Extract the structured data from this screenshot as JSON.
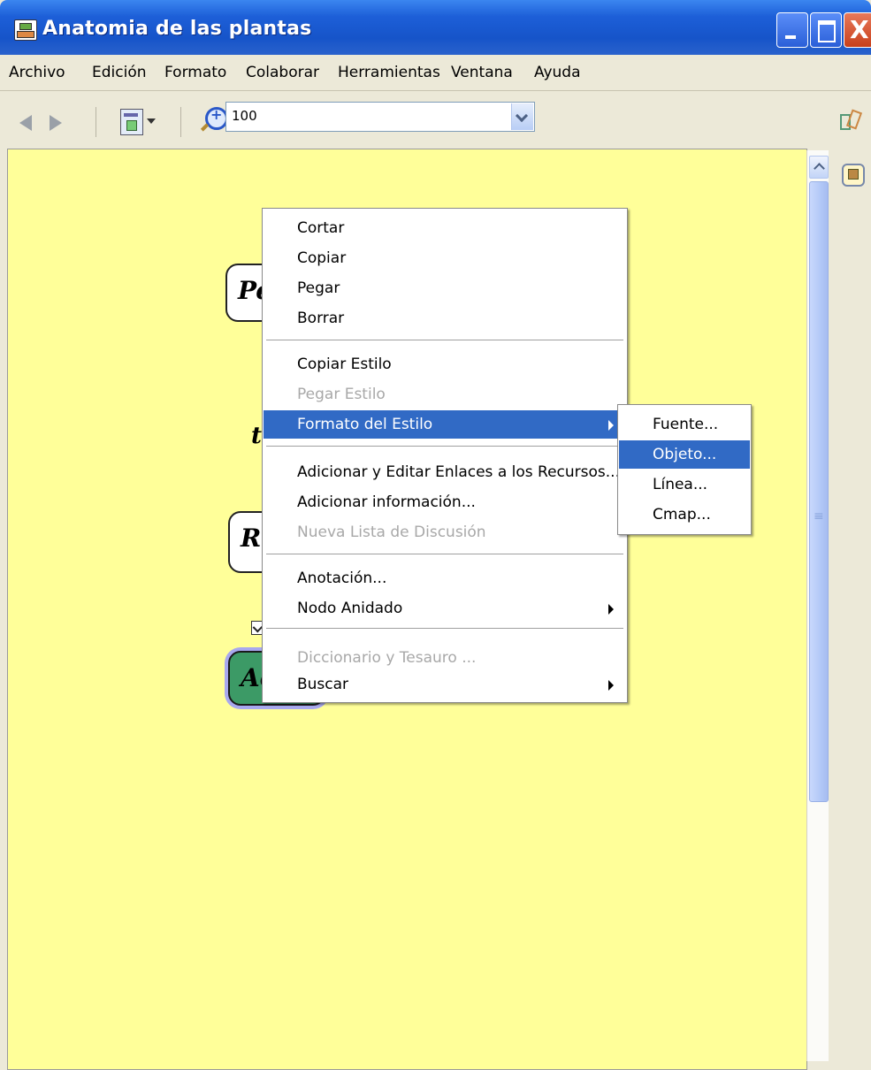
{
  "window": {
    "title": "Anatomia de las plantas",
    "close_glyph": "X"
  },
  "menubar": [
    "Archivo",
    "Edición",
    "Formato",
    "Colaborar",
    "Herramientas",
    "Ventana",
    "Ayuda"
  ],
  "toolbar": {
    "zoom_value": "100"
  },
  "canvas": {
    "background": "#ffff99",
    "nodes": [
      {
        "text": "Pe"
      },
      {
        "text": "Ra"
      },
      {
        "text": "Ac"
      }
    ],
    "link_word": "t"
  },
  "context_menu": {
    "groups": [
      [
        {
          "label": "Cortar",
          "enabled": true
        },
        {
          "label": "Copiar",
          "enabled": true
        },
        {
          "label": "Pegar",
          "enabled": true
        },
        {
          "label": "Borrar",
          "enabled": true
        }
      ],
      [
        {
          "label": "Copiar Estilo",
          "enabled": true
        },
        {
          "label": "Pegar Estilo",
          "enabled": false
        },
        {
          "label": "Formato del Estilo",
          "enabled": true,
          "submenu": true,
          "highlighted": true
        }
      ],
      [
        {
          "label": "Adicionar y Editar Enlaces a los Recursos...",
          "enabled": true
        },
        {
          "label": "Adicionar información...",
          "enabled": true
        },
        {
          "label": "Nueva Lista de Discusión",
          "enabled": false
        }
      ],
      [
        {
          "label": "Anotación...",
          "enabled": true
        },
        {
          "label": "Nodo Anidado",
          "enabled": true,
          "submenu": true
        }
      ],
      [
        {
          "label": "Diccionario y Tesauro ...",
          "enabled": false
        },
        {
          "label": "Buscar",
          "enabled": true,
          "submenu": true
        }
      ]
    ]
  },
  "submenu": {
    "items": [
      {
        "label": "Fuente...",
        "highlighted": false
      },
      {
        "label": "Objeto...",
        "highlighted": true
      },
      {
        "label": "Línea...",
        "highlighted": false
      },
      {
        "label": "Cmap...",
        "highlighted": false
      }
    ]
  },
  "colors": {
    "title_bar": "#1d5fd8",
    "highlight": "#316ac5",
    "canvas": "#ffff99",
    "selected_node": "#3c9a66"
  }
}
